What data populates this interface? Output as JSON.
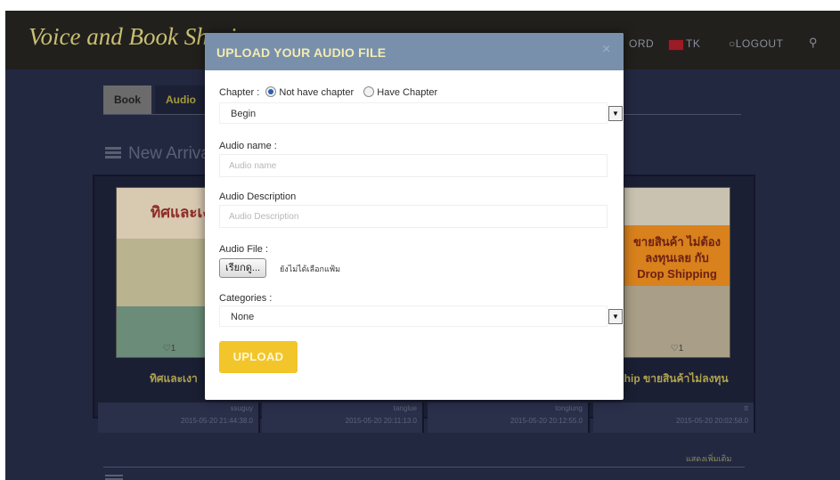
{
  "navbar": {
    "brand": "Voice and Book Sharing",
    "password_link": "ORD",
    "user": "TK",
    "logout": "LOGOUT",
    "search_icon": "search-icon"
  },
  "tabs": [
    {
      "label": "Book"
    },
    {
      "label": "Audio"
    }
  ],
  "section": {
    "title": "New Arrivals",
    "icon": "list-icon"
  },
  "books": [
    {
      "cover_text": "ทิศและเงา",
      "title": "ทิศและเงา",
      "likes": "♡1",
      "user": "ssuguy",
      "date": "2015-05-20  21:44:38.0"
    },
    {
      "user": "tanglue",
      "date": "2015-05-20  20:11:13.0"
    },
    {
      "user": "tonglung",
      "date": "2015-05-20  20:12:55.0"
    },
    {
      "cover_text": "ขายสินค้า ไม่ต้องลงทุนเลย กับ Drop Shipping",
      "title": "ship ขายสินค้าไม่ลงทุน",
      "likes": "♡1",
      "user": "tt",
      "date": "2015-05-20  20:02:58.0"
    }
  ],
  "more_link": "แสดงเพิ่มเติม",
  "modal": {
    "title": "UPLOAD YOUR AUDIO FILE",
    "close": "×",
    "chapter_label": "Chapter :",
    "radio_no_chapter": "Not have chapter",
    "radio_have_chapter": "Have Chapter",
    "chapter_select_value": "Begin",
    "audio_name_label": "Audio name :",
    "audio_name_placeholder": "Audio name",
    "audio_desc_label": "Audio Description",
    "audio_desc_placeholder": "Audio Description",
    "audio_file_label": "Audio File :",
    "file_button": "เรียกดู...",
    "file_status": "ยังไม่ได้เลือกแฟ้ม",
    "categories_label": "Categories :",
    "categories_value": "None",
    "upload_button": "UPLOAD"
  },
  "colors": {
    "modal_header": "#7990ad",
    "upload_button": "#f2c52a",
    "navbar": "#22201d",
    "backdrop": "#232841"
  }
}
